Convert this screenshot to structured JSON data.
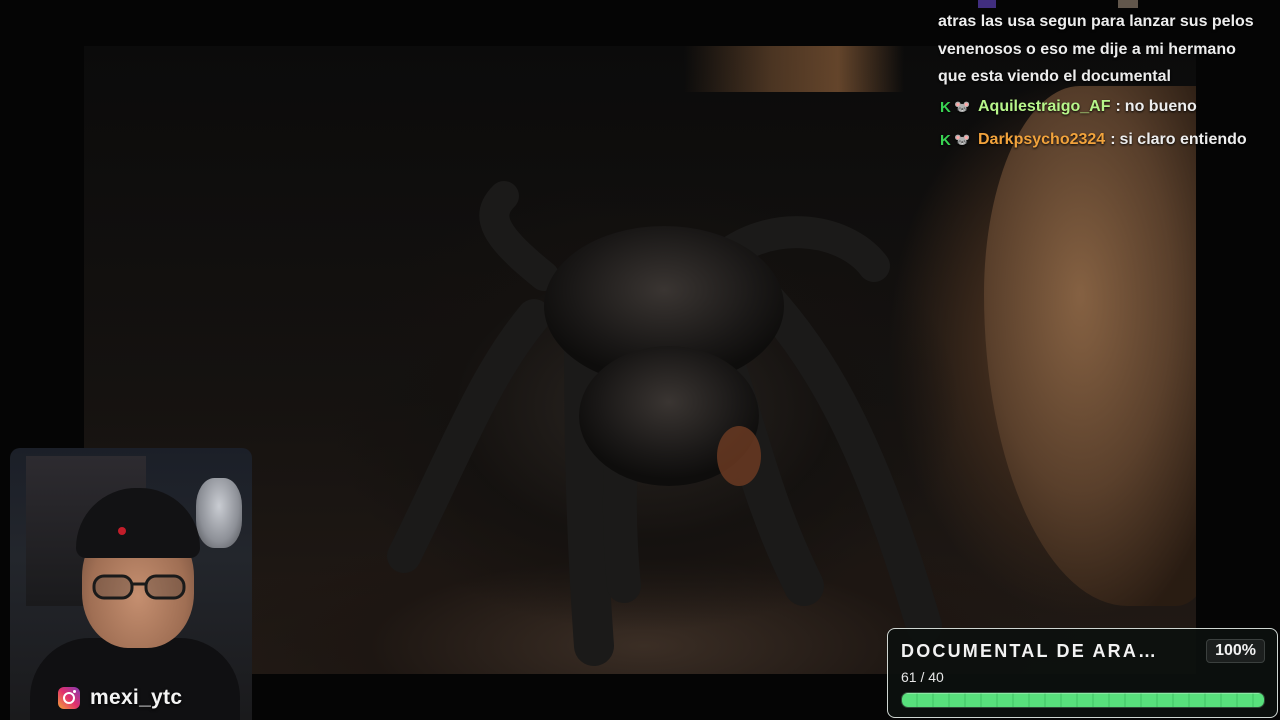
{
  "chat": {
    "continued_lines": [
      "atras las usa segun para lanzar sus pelos",
      "venenosos o eso me dije a mi hermano",
      "que esta viendo el documental"
    ],
    "messages": [
      {
        "badge": "K",
        "user": "Aquilestraigo_AF",
        "text": "no bueno",
        "user_color": "#b7f58a"
      },
      {
        "badge": "K",
        "user": "Darkpsycho2324",
        "text": "si claro entiendo",
        "user_color": "#f2a33c"
      }
    ]
  },
  "goal": {
    "title": "DOCUMENTAL DE ARA…",
    "percent_label": "100%",
    "count": "61 / 40",
    "progress_fraction": 1.0
  },
  "webcam": {
    "social_handle": "mexi_ytc",
    "social_icon": "instagram-icon"
  },
  "colors": {
    "badge_green": "#39d353",
    "progress_green": "#58e07c"
  }
}
